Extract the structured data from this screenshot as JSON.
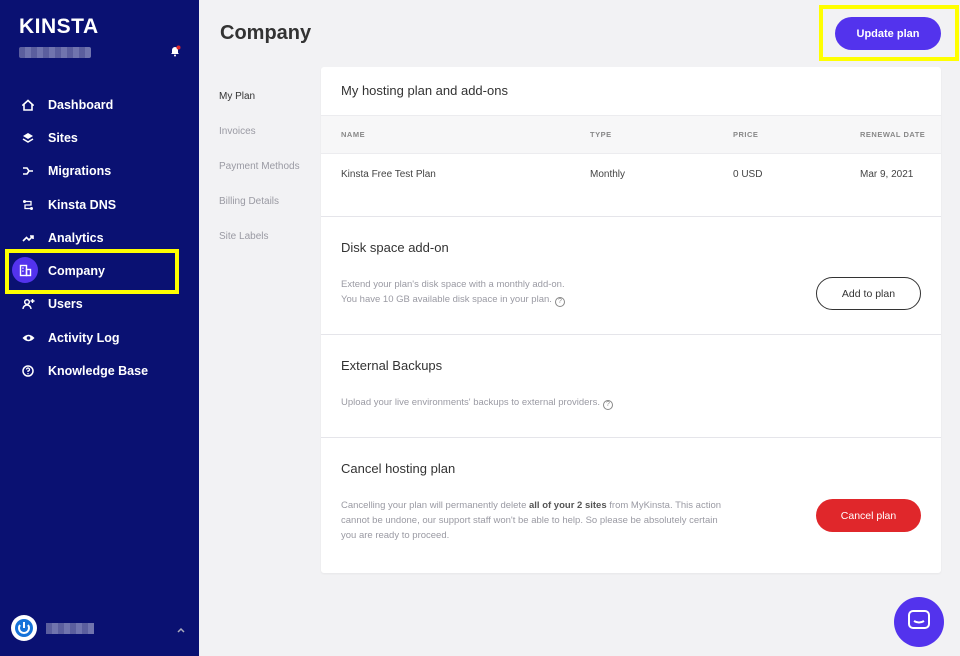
{
  "brand": {
    "logo": "KINSTA",
    "accent": "#5333ed",
    "sidebar_bg": "#0a1172",
    "highlight": "#ffff00",
    "danger": "#e0272b"
  },
  "header": {
    "title": "Company",
    "update_label": "Update plan"
  },
  "sidebar": {
    "items": [
      {
        "label": "Dashboard",
        "icon": "home-icon"
      },
      {
        "label": "Sites",
        "icon": "layers-icon"
      },
      {
        "label": "Migrations",
        "icon": "migrations-icon"
      },
      {
        "label": "Kinsta DNS",
        "icon": "dns-icon"
      },
      {
        "label": "Analytics",
        "icon": "trend-icon"
      },
      {
        "label": "Company",
        "icon": "building-icon",
        "active": true
      },
      {
        "label": "Users",
        "icon": "user-plus-icon"
      },
      {
        "label": "Activity Log",
        "icon": "eye-icon"
      },
      {
        "label": "Knowledge Base",
        "icon": "question-icon"
      }
    ]
  },
  "subnav": {
    "items": [
      {
        "label": "My Plan"
      },
      {
        "label": "Invoices"
      },
      {
        "label": "Payment Methods"
      },
      {
        "label": "Billing Details"
      },
      {
        "label": "Site Labels"
      }
    ]
  },
  "plan": {
    "title": "My hosting plan and add-ons",
    "columns": [
      "NAME",
      "TYPE",
      "PRICE",
      "RENEWAL DATE"
    ],
    "row": {
      "name": "Kinsta Free Test Plan",
      "type": "Monthly",
      "price": "0 USD",
      "renewal": "Mar 9, 2021"
    }
  },
  "disk": {
    "title": "Disk space add-on",
    "line1": "Extend your plan's disk space with a monthly add-on.",
    "line2": "You have 10 GB available disk space in your plan.",
    "button": "Add to plan"
  },
  "backups": {
    "title": "External Backups",
    "desc": "Upload your live environments' backups to external providers."
  },
  "cancel": {
    "title": "Cancel hosting plan",
    "desc_before": "Cancelling your plan will permanently delete ",
    "desc_bold": "all of your 2 sites",
    "desc_after": " from MyKinsta. This action cannot be undone, our support staff won't be able to help. So please be absolutely certain you are ready to proceed.",
    "button": "Cancel plan"
  }
}
